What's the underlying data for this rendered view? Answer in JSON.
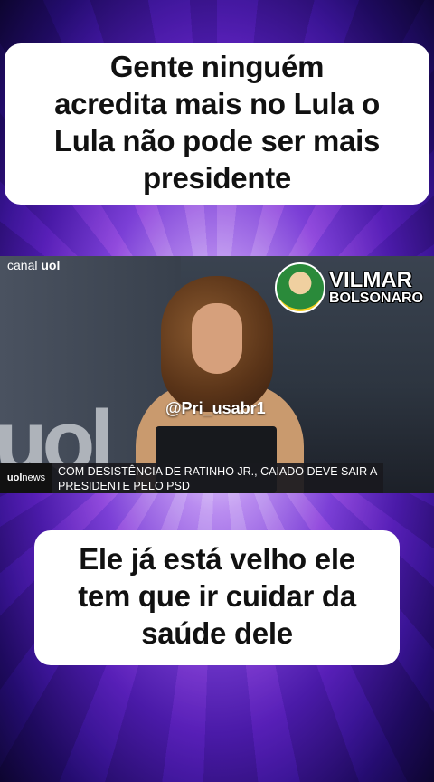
{
  "top_caption": {
    "lines": [
      "Gente ninguém",
      "acredita mais no Lula o",
      "Lula não pode ser mais",
      "presidente"
    ]
  },
  "video": {
    "channel_logo": {
      "prefix": "canal",
      "brand": "uol"
    },
    "background_logo": "uol",
    "watermark": "@Pri_usabr1",
    "ticker": {
      "brand": "uol",
      "brand_suffix": "news",
      "headline": "COM DESISTÊNCIA DE RATINHO JR., CAIADO DEVE SAIR A PRESIDENTE PELO PSD"
    }
  },
  "badge": {
    "line1": "VILMAR",
    "line2": "BOLSONARO"
  },
  "bottom_caption": {
    "lines": [
      "Ele já está velho ele",
      "tem que ir cuidar da",
      "saúde dele"
    ]
  },
  "colors": {
    "background": "#6a2fd0",
    "caption_bg": "#ffffff",
    "caption_text": "#111111"
  }
}
